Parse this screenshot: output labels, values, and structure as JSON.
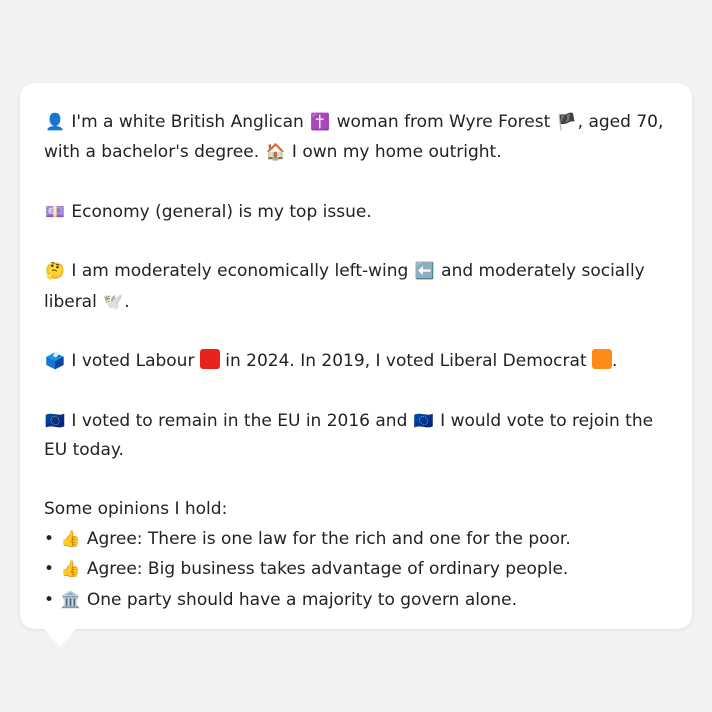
{
  "message": {
    "p1": {
      "icon1": "👤",
      "text1": " I'm a white British Anglican ",
      "icon2": "✝️",
      "text2": " woman from Wyre Forest ",
      "icon3": "🏴",
      "text3": ", aged 70, with a bachelor's degree. ",
      "icon4": "🏠",
      "text4": " I own my home outright."
    },
    "p2": {
      "icon1": "💷",
      "text1": " Economy (general) is my top issue."
    },
    "p3": {
      "icon1": "🤔",
      "text1": " I am moderately economically left-wing ",
      "icon2": "⬅️",
      "text2": " and moderately socially liberal ",
      "icon3": "🕊️",
      "text3": "."
    },
    "p4": {
      "icon1": "🗳️",
      "text1": " I voted Labour ",
      "text2": " in 2024. In 2019, I voted Liberal Democrat ",
      "text3": "."
    },
    "p5": {
      "icon1": "🇪🇺",
      "text1": " I voted to remain in the EU in 2016 and ",
      "icon2": "🇪🇺",
      "text2": " I would vote to rejoin the EU today."
    },
    "opinions_heading": "Some opinions I hold:",
    "opinions": [
      {
        "bullet": "•",
        "icon": "👍",
        "text": " Agree: There is one law for the rich and one for the poor."
      },
      {
        "bullet": "•",
        "icon": "👍",
        "text": " Agree: Big business takes advantage of ordinary people."
      },
      {
        "bullet": "•",
        "icon": "🏛️",
        "text": " One party should have a majority to govern alone."
      }
    ]
  },
  "colors": {
    "labour": "#e8231b",
    "libdem": "#fb8c1a",
    "card": "#ffffff",
    "background": "#f1f2f4"
  }
}
